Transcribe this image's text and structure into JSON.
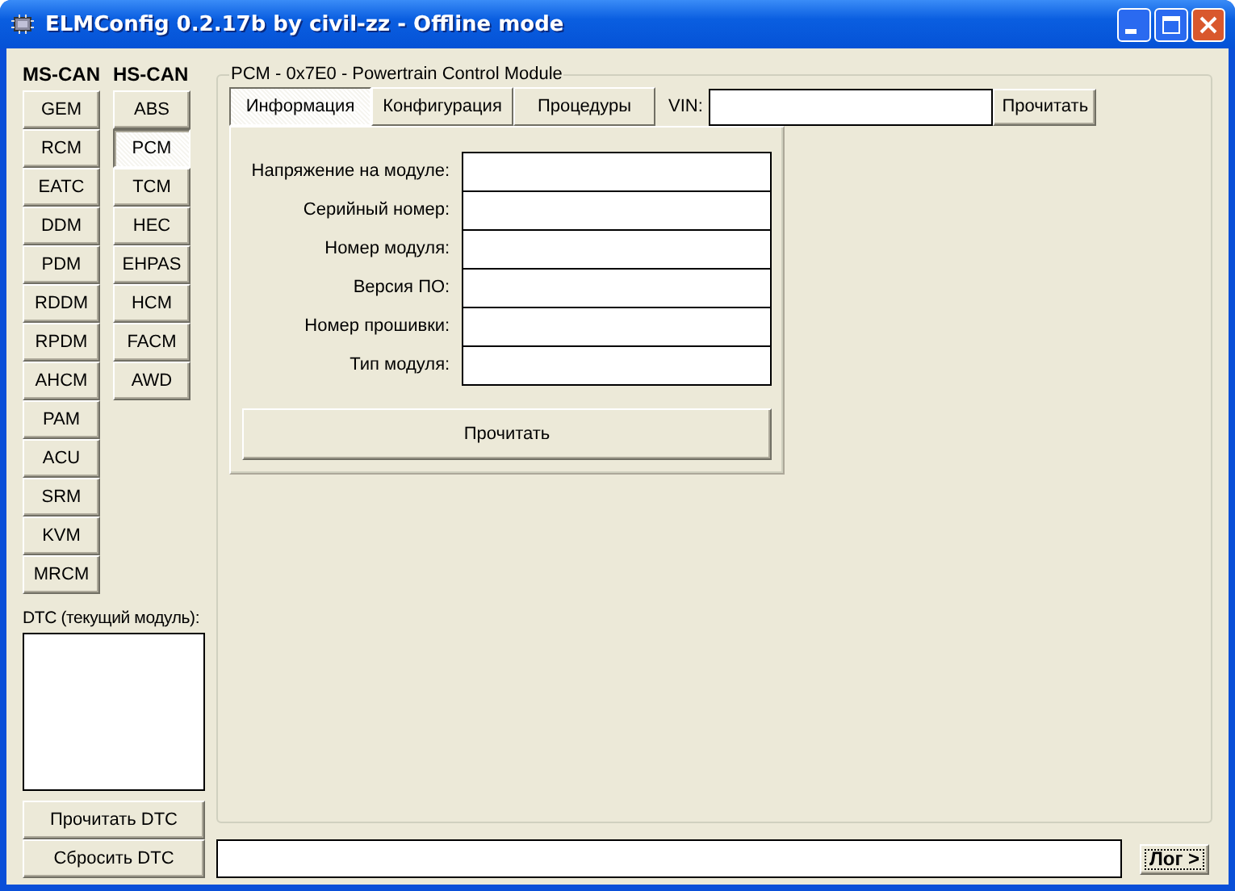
{
  "window": {
    "title": "ELMConfig 0.2.17b by civil-zz - Offline mode"
  },
  "ms_can": {
    "label": "MS-CAN",
    "modules": [
      {
        "label": "GEM",
        "selected": false
      },
      {
        "label": "RCM",
        "selected": false
      },
      {
        "label": "EATC",
        "selected": false
      },
      {
        "label": "DDM",
        "selected": false
      },
      {
        "label": "PDM",
        "selected": false
      },
      {
        "label": "RDDM",
        "selected": false
      },
      {
        "label": "RPDM",
        "selected": false
      },
      {
        "label": "AHCM",
        "selected": false
      },
      {
        "label": "PAM",
        "selected": false
      },
      {
        "label": "ACU",
        "selected": false
      },
      {
        "label": "SRM",
        "selected": false
      },
      {
        "label": "KVM",
        "selected": false
      },
      {
        "label": "MRCM",
        "selected": false
      }
    ]
  },
  "hs_can": {
    "label": "HS-CAN",
    "modules": [
      {
        "label": "ABS",
        "selected": false
      },
      {
        "label": "PCM",
        "selected": true
      },
      {
        "label": "TCM",
        "selected": false
      },
      {
        "label": "HEC",
        "selected": false
      },
      {
        "label": "EHPAS",
        "selected": false
      },
      {
        "label": "HCM",
        "selected": false
      },
      {
        "label": "FACM",
        "selected": false
      },
      {
        "label": "AWD",
        "selected": false
      }
    ]
  },
  "dtc": {
    "label": "DTC (текущий модуль):",
    "buttons": [
      "Прочитать DTC",
      "Сбросить DTC"
    ]
  },
  "module_panel": {
    "title": "PCM - 0x7E0 - Powertrain Control Module",
    "tabs": [
      {
        "label": "Информация",
        "selected": true
      },
      {
        "label": "Конфигурация",
        "selected": false
      },
      {
        "label": "Процедуры",
        "selected": false
      }
    ],
    "vin": {
      "label": "VIN:",
      "button": "Прочитать"
    },
    "fields": [
      {
        "label": "Напряжение на модуле:"
      },
      {
        "label": "Серийный номер:"
      },
      {
        "label": "Номер модуля:"
      },
      {
        "label": "Версия ПО:"
      },
      {
        "label": "Номер прошивки:"
      },
      {
        "label": "Тип модуля:"
      }
    ],
    "read_button": "Прочитать"
  },
  "status_bar": {
    "log_button": "Лог >"
  }
}
